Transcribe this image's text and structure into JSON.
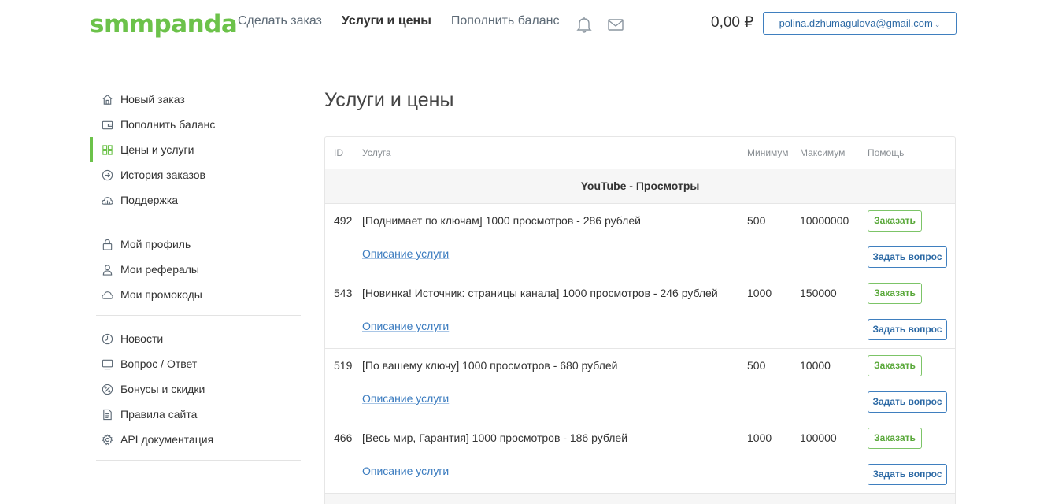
{
  "header": {
    "logo": "smmpanda",
    "nav": [
      {
        "label": "Сделать заказ"
      },
      {
        "label": "Услуги и цены"
      },
      {
        "label": "Пополнить баланс"
      }
    ],
    "balance": "0,00 ₽",
    "user_email": "polina.dzhumagulova@gmail.com",
    "icons": [
      "bell-icon",
      "mail-icon"
    ]
  },
  "sidebar": {
    "groups": [
      {
        "items": [
          {
            "label": "Новый заказ",
            "icon": "home-icon"
          },
          {
            "label": "Пополнить баланс",
            "icon": "wallet-icon"
          },
          {
            "label": "Цены и услуги",
            "icon": "grid-icon"
          },
          {
            "label": "История заказов",
            "icon": "arrow-circle-icon"
          },
          {
            "label": "Поддержка",
            "icon": "chart-cloud-icon"
          }
        ]
      },
      {
        "items": [
          {
            "label": "Мой профиль",
            "icon": "lock-icon"
          },
          {
            "label": "Мои рефералы",
            "icon": "user-icon"
          },
          {
            "label": "Мои промокоды",
            "icon": "cloud-icon"
          }
        ]
      },
      {
        "items": [
          {
            "label": "Новости",
            "icon": "clock-icon"
          },
          {
            "label": "Вопрос / Ответ",
            "icon": "monitor-icon"
          },
          {
            "label": "Бонусы и скидки",
            "icon": "percent-icon"
          },
          {
            "label": "Правила сайта",
            "icon": "document-icon"
          },
          {
            "label": "API документация",
            "icon": "gear-icon"
          }
        ]
      }
    ]
  },
  "main": {
    "title": "Услуги и цены",
    "table": {
      "headers": {
        "id": "ID",
        "service": "Услуга",
        "min": "Минимум",
        "max": "Максимум",
        "help": "Помощь"
      },
      "category": "YouTube - Просмотры",
      "rows": [
        {
          "id": "492",
          "name": "[Поднимает по ключам] 1000 просмотров - 286 рублей",
          "min": "500",
          "max": "10000000",
          "desc": "Описание услуги",
          "order": "Заказать",
          "ask": "Задать вопрос"
        },
        {
          "id": "543",
          "name": "[Новинка! Источник: страницы канала] 1000 просмотров - 246 рублей",
          "min": "1000",
          "max": "150000",
          "desc": "Описание услуги",
          "order": "Заказать",
          "ask": "Задать вопрос"
        },
        {
          "id": "519",
          "name": "[По вашему ключу] 1000 просмотров - 680 рублей",
          "min": "500",
          "max": "10000",
          "desc": "Описание услуги",
          "order": "Заказать",
          "ask": "Задать вопрос"
        },
        {
          "id": "466",
          "name": "[Весь мир, Гарантия] 1000 просмотров - 186 рублей",
          "min": "1000",
          "max": "100000",
          "desc": "Описание услуги",
          "order": "Заказать",
          "ask": "Задать вопрос"
        }
      ]
    }
  },
  "colors": {
    "brand_green": "#6cc24a",
    "link_blue": "#3a7bbf"
  }
}
